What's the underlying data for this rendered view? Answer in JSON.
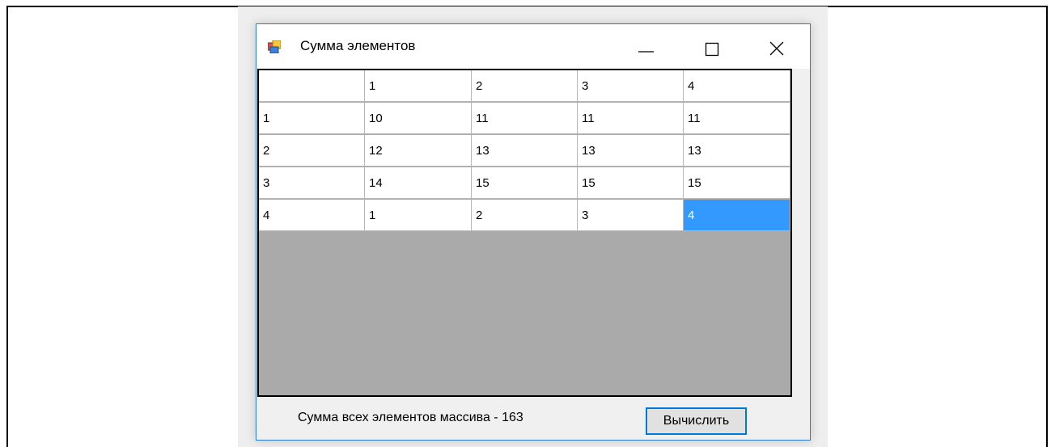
{
  "window": {
    "title": "Сумма элементов"
  },
  "grid": {
    "rows": [
      [
        "",
        "1",
        "2",
        "3",
        "4"
      ],
      [
        "1",
        "10",
        "11",
        "11",
        "11"
      ],
      [
        "2",
        "12",
        "13",
        "13",
        "13"
      ],
      [
        "3",
        "14",
        "15",
        "15",
        "15"
      ],
      [
        "4",
        "1",
        "2",
        "3",
        "4"
      ]
    ],
    "selected_cell": {
      "row": 4,
      "col": 4
    },
    "selection_color": "#3399ff",
    "empty_area_color": "#aaaaaa"
  },
  "footer": {
    "sum_label": "Сумма всех элементов массива - 163",
    "calculate_button": "Вычислить"
  },
  "colors": {
    "window_border": "#2b79d0",
    "button_border": "#0078d7"
  }
}
